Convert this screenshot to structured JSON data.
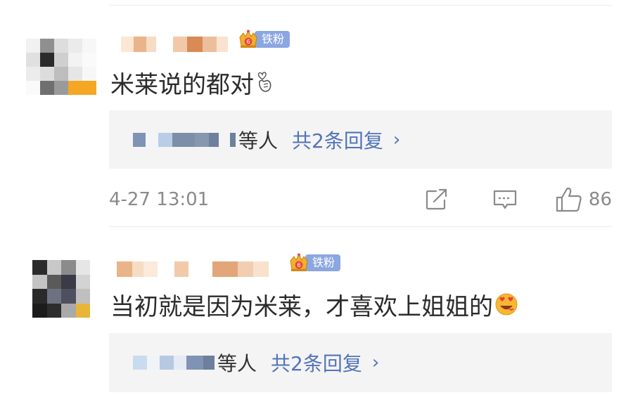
{
  "top_divider": true,
  "comments": [
    {
      "author_redacted": true,
      "fan_badge": {
        "level": "6",
        "label": "铁粉"
      },
      "text": "米莱说的都对",
      "emoji": "finger-heart-emoji",
      "replies": {
        "names_redacted": true,
        "suffix": "等人",
        "count_text": "共2条回复",
        "chevron": "›"
      },
      "timestamp": "4-27 13:01",
      "actions": {
        "share_icon": "share-icon",
        "reply_icon": "comment-icon",
        "like_icon": "thumbs-up-icon",
        "like_count": "86"
      }
    },
    {
      "author_redacted": true,
      "fan_badge": {
        "level": "6",
        "label": "铁粉"
      },
      "text": "当初就是因为米莱，才喜欢上姐姐的",
      "emoji": "heart-face-emoji",
      "replies": {
        "names_redacted": true,
        "suffix": "等人",
        "count_text": "共2条回复",
        "chevron": "›"
      }
    }
  ],
  "colors": {
    "link": "#5274b8",
    "muted": "#8a8a8a",
    "reply_bg": "#f4f4f4",
    "badge_bg": "#8ba6e0"
  }
}
